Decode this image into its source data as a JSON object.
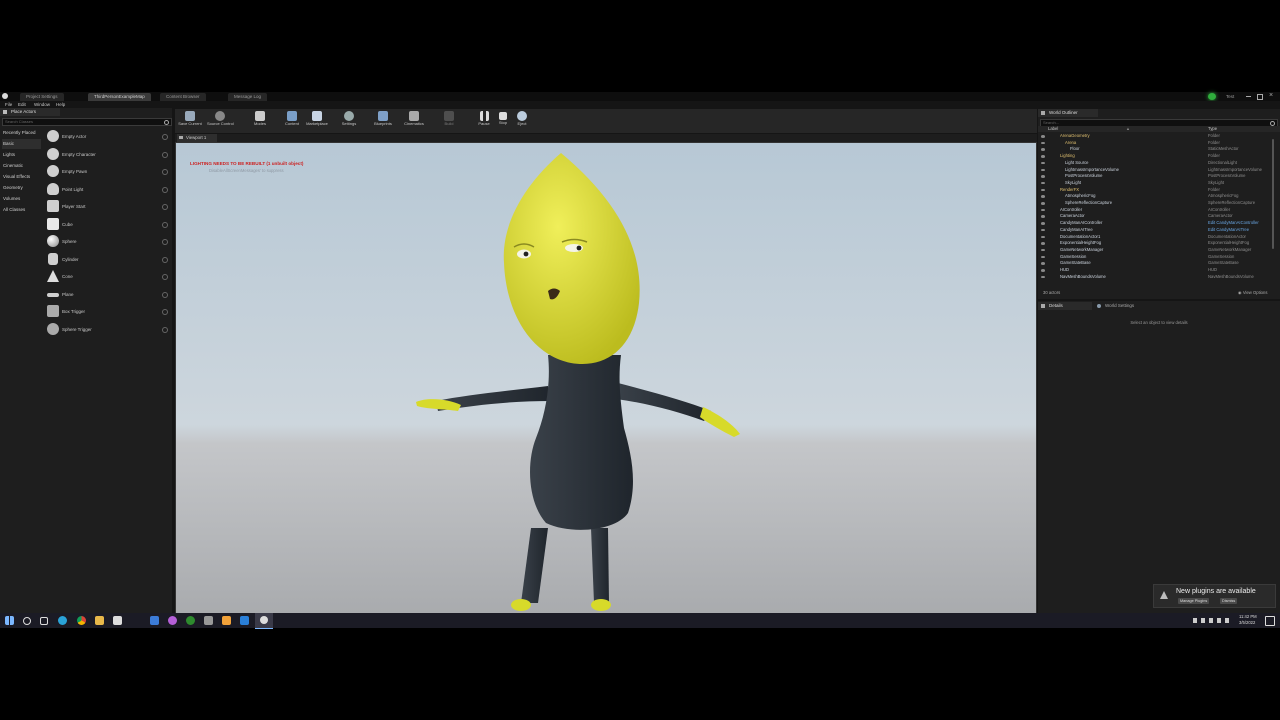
{
  "window": {
    "tabs": [
      "Project Settings",
      "ThirdPersonExampleMap",
      "Content Browser",
      "Message Log"
    ],
    "user_label": "Test",
    "menu": [
      "File",
      "Edit",
      "Window",
      "Help"
    ]
  },
  "place_actors": {
    "tab_label": "Place Actors",
    "search_placeholder": "Search Classes",
    "categories": [
      "Recently Placed",
      "Basic",
      "Lights",
      "Cinematic",
      "Visual Effects",
      "Geometry",
      "Volumes",
      "All Classes"
    ],
    "active_category": "Basic",
    "actors": [
      "Empty Actor",
      "Empty Character",
      "Empty Pawn",
      "Point Light",
      "Player Start",
      "Cube",
      "Sphere",
      "Cylinder",
      "Cone",
      "Plane",
      "Box Trigger",
      "Sphere Trigger"
    ]
  },
  "toolbar": {
    "buttons": [
      "Save Current",
      "Source Control",
      "Modes",
      "Content",
      "Marketplace",
      "Settings",
      "Blueprints",
      "Cinematics",
      "Build",
      "Pause",
      "Stop",
      "Eject"
    ]
  },
  "viewport": {
    "tab_label": "Viewport 1",
    "warning": "LIGHTING NEEDS TO BE REBUILT (1 unbuilt object)",
    "warning_sub": "DisableAllScreenMessages' to suppress"
  },
  "outliner": {
    "tab_label": "World Outliner",
    "search_placeholder": "Search...",
    "col_label": "Label",
    "col_type": "Type",
    "rows": [
      {
        "label": "ArenaGeometry",
        "type": "Folder",
        "indent": 0,
        "link": false
      },
      {
        "label": "Arena",
        "type": "Folder",
        "indent": 1,
        "link": false
      },
      {
        "label": "Floor",
        "type": "StaticMeshActor",
        "indent": 2,
        "link": false
      },
      {
        "label": "Lighting",
        "type": "Folder",
        "indent": 0,
        "link": false
      },
      {
        "label": "Light Source",
        "type": "DirectionalLight",
        "indent": 1,
        "link": false
      },
      {
        "label": "LightmassImportanceVolume",
        "type": "LightmassImportanceVolume",
        "indent": 1,
        "link": false
      },
      {
        "label": "PostProcessVolume",
        "type": "PostProcessVolume",
        "indent": 1,
        "link": false
      },
      {
        "label": "SkyLight",
        "type": "SkyLight",
        "indent": 1,
        "link": false
      },
      {
        "label": "RenderFX",
        "type": "Folder",
        "indent": 0,
        "link": false
      },
      {
        "label": "AtmosphericFog",
        "type": "AtmosphericFog",
        "indent": 1,
        "link": false
      },
      {
        "label": "SphereReflectionCapture",
        "type": "SphereReflectionCapture",
        "indent": 1,
        "link": false
      },
      {
        "label": "AIController",
        "type": "AIController",
        "indent": 0,
        "link": false
      },
      {
        "label": "CameraActor",
        "type": "CameraActor",
        "indent": 0,
        "link": false
      },
      {
        "label": "CandyManAIController",
        "type": "Edit CandyManAIController",
        "indent": 0,
        "link": true
      },
      {
        "label": "CandyManAITree",
        "type": "Edit CandyManAITree",
        "indent": 0,
        "link": true
      },
      {
        "label": "DocumentationActor1",
        "type": "DocumentationActor",
        "indent": 0,
        "link": false
      },
      {
        "label": "ExponentialHeightFog",
        "type": "ExponentialHeightFog",
        "indent": 0,
        "link": false
      },
      {
        "label": "GameNetworkManager",
        "type": "GameNetworkManager",
        "indent": 0,
        "link": false
      },
      {
        "label": "GameSession",
        "type": "GameSession",
        "indent": 0,
        "link": false
      },
      {
        "label": "GameStateBase",
        "type": "GameStateBase",
        "indent": 0,
        "link": false
      },
      {
        "label": "HUD",
        "type": "HUD",
        "indent": 0,
        "link": false
      },
      {
        "label": "NavMeshBoundsVolume",
        "type": "NavMeshBoundsVolume",
        "indent": 0,
        "link": false
      }
    ],
    "count": "30 actors",
    "view_options": "View Options"
  },
  "details": {
    "tab_details": "Details",
    "tab_world_settings": "World Settings",
    "empty_message": "Select an object to view details"
  },
  "notification": {
    "title": "New plugins are available",
    "manage": "Manage Plugins",
    "dismiss": "Dismiss"
  },
  "taskbar": {
    "time": "11:42 PM",
    "date": "3/5/2022"
  },
  "colors": {
    "character_head": "#dede3a",
    "character_body": "#2c323a",
    "warning_red": "#cc2222",
    "link_blue": "#6aa7e4"
  }
}
